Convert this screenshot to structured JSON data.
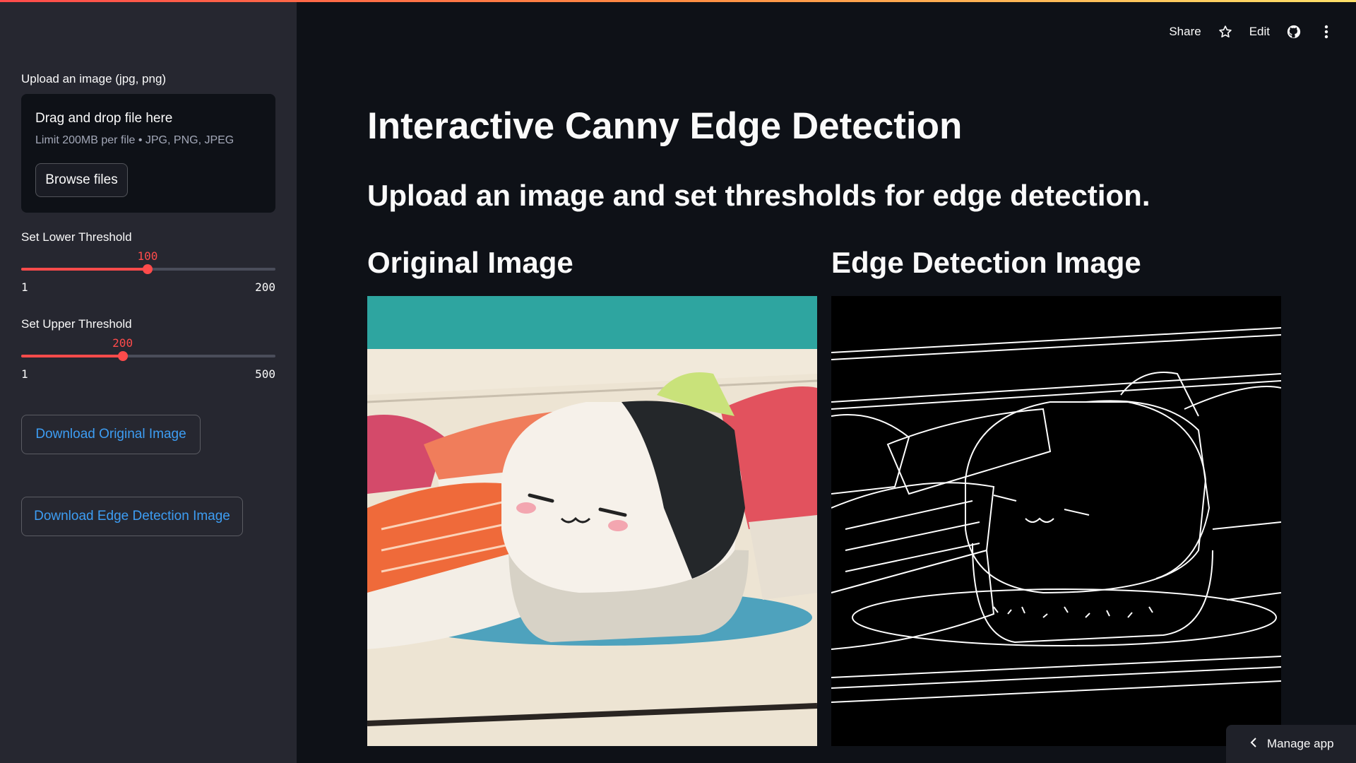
{
  "sidebar": {
    "upload_label": "Upload an image (jpg, png)",
    "dropzone_title": "Drag and drop file here",
    "dropzone_sub": "Limit 200MB per file • JPG, PNG, JPEG",
    "browse_label": "Browse files",
    "lower": {
      "label": "Set Lower Threshold",
      "value": "100",
      "min": "1",
      "max": "200",
      "fraction": 0.497
    },
    "upper": {
      "label": "Set Upper Threshold",
      "value": "200",
      "min": "1",
      "max": "500",
      "fraction": 0.399
    },
    "download_original": "Download Original Image",
    "download_edges": "Download Edge Detection Image"
  },
  "toolbar": {
    "share": "Share",
    "edit": "Edit",
    "icons": [
      "star-icon",
      "github-icon",
      "more-vertical-icon"
    ]
  },
  "main": {
    "title": "Interactive Canny Edge Detection",
    "subtitle": "Upload an image and set thresholds for edge detection.",
    "col_original": "Original Image",
    "col_edges": "Edge Detection Image"
  },
  "manage_app": "Manage app",
  "colors": {
    "accent": "#ff4b4b",
    "link": "#3d9df3",
    "sidebar_bg": "#262730",
    "main_bg": "#0e1117"
  }
}
